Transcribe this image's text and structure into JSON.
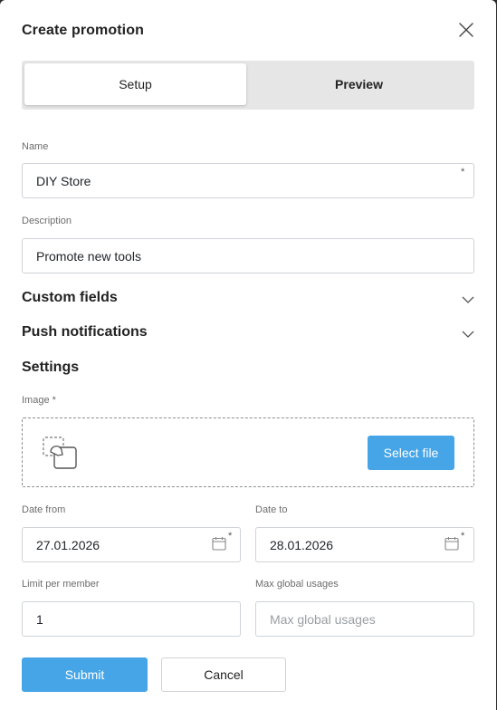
{
  "modal": {
    "title": "Create promotion"
  },
  "tabs": [
    {
      "label": "Setup",
      "active": true
    },
    {
      "label": "Preview",
      "active": false
    }
  ],
  "form": {
    "name": {
      "label": "Name",
      "value": "DIY Store",
      "required_mark": "*"
    },
    "description": {
      "label": "Description",
      "value": "Promote new tools"
    },
    "sections": {
      "custom_fields": "Custom fields",
      "push_notifications": "Push notifications",
      "settings": "Settings"
    },
    "image": {
      "label": "Image *",
      "button": "Select file",
      "icon": "image-upload-icon"
    },
    "date_from": {
      "label": "Date from",
      "value": "27.01.2026",
      "required_mark": "*",
      "icon": "calendar-icon"
    },
    "date_to": {
      "label": "Date to",
      "value": "28.01.2026",
      "required_mark": "*",
      "icon": "calendar-icon"
    },
    "limit_per_member": {
      "label": "Limit per member",
      "value": "1"
    },
    "max_global_usages": {
      "label": "Max global usages",
      "value": "",
      "placeholder": "Max global usages"
    }
  },
  "actions": {
    "submit": "Submit",
    "cancel": "Cancel"
  },
  "colors": {
    "accent": "#45a5e6",
    "tab_bg": "#e6e6e6",
    "border": "#cfd3d7"
  }
}
